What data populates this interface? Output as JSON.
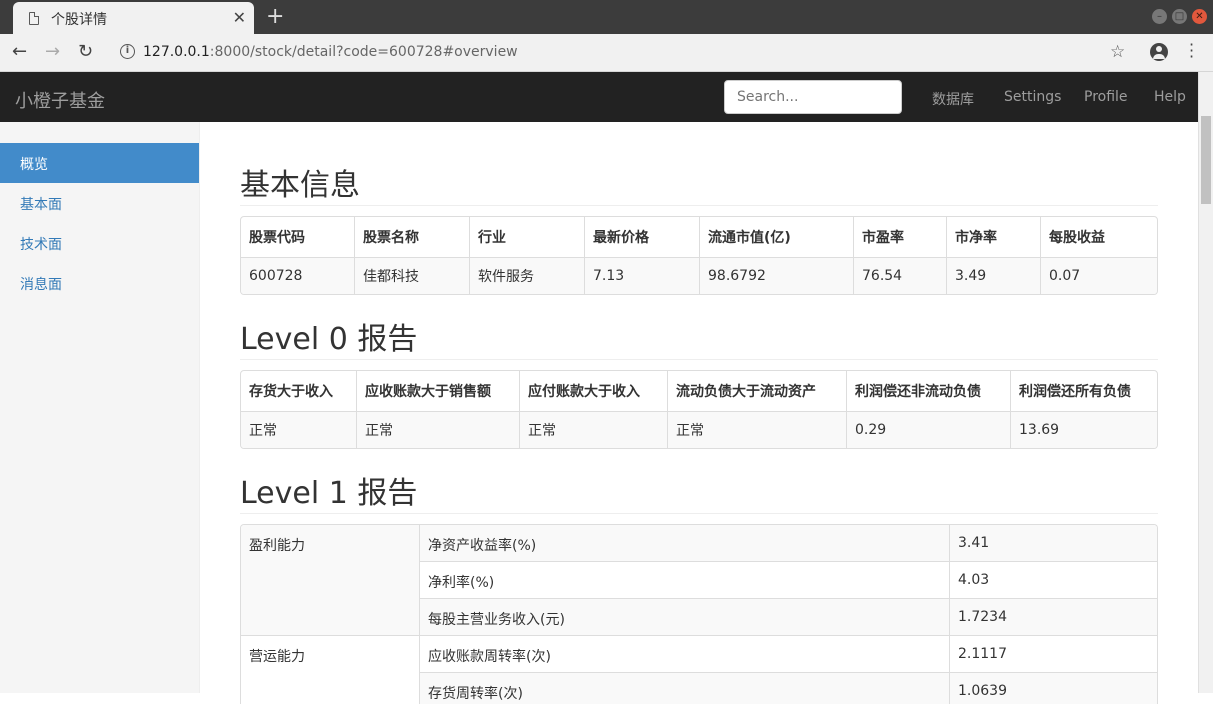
{
  "browser": {
    "tab_title": "个股详情",
    "url_host": "127.0.0.1",
    "url_rest": ":8000/stock/detail?code=600728#overview"
  },
  "navbar": {
    "brand": "小橙子基金",
    "search_placeholder": "Search...",
    "links": [
      "数据库",
      "Settings",
      "Profile",
      "Help"
    ]
  },
  "sidebar": {
    "items": [
      "概览",
      "基本面",
      "技术面",
      "消息面"
    ],
    "active": "概览"
  },
  "basic": {
    "title": "基本信息",
    "headers": [
      "股票代码",
      "股票名称",
      "行业",
      "最新价格",
      "流通市值(亿)",
      "市盈率",
      "市净率",
      "每股收益"
    ],
    "values": [
      "600728",
      "佳都科技",
      "软件服务",
      "7.13",
      "98.6792",
      "76.54",
      "3.49",
      "0.07"
    ]
  },
  "level0": {
    "title": "Level 0 报告",
    "headers": [
      "存货大于收入",
      "应收账款大于销售额",
      "应付账款大于收入",
      "流动负债大于流动资产",
      "利润偿还非流动负债",
      "利润偿还所有负债"
    ],
    "values": [
      "正常",
      "正常",
      "正常",
      "正常",
      "0.29",
      "13.69"
    ]
  },
  "level1": {
    "title": "Level 1 报告",
    "groups": [
      {
        "name": "盈利能力",
        "rows": [
          {
            "label": "净资产收益率(%)",
            "value": "3.41"
          },
          {
            "label": "净利率(%)",
            "value": "4.03"
          },
          {
            "label": "每股主营业务收入(元)",
            "value": "1.7234"
          }
        ]
      },
      {
        "name": "营运能力",
        "rows": [
          {
            "label": "应收账款周转率(次)",
            "value": "2.1117"
          },
          {
            "label": "存货周转率(次)",
            "value": "1.0639"
          }
        ]
      }
    ]
  }
}
